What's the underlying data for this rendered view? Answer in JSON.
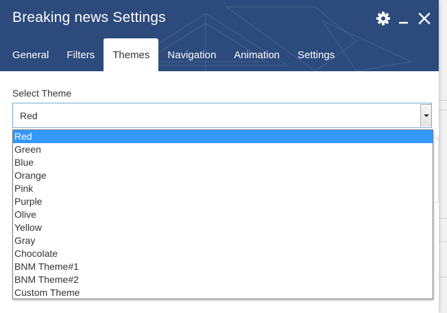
{
  "dialog": {
    "title": "Breaking news Settings",
    "icons": {
      "settings": "gear-icon",
      "minimize": "minimize-icon",
      "close": "close-icon"
    },
    "header_color": "#2c4a7c"
  },
  "tabs": [
    {
      "label": "General",
      "active": false
    },
    {
      "label": "Filters",
      "active": false
    },
    {
      "label": "Themes",
      "active": true
    },
    {
      "label": "Navigation",
      "active": false
    },
    {
      "label": "Animation",
      "active": false
    },
    {
      "label": "Settings",
      "active": false
    }
  ],
  "theme": {
    "label": "Select Theme",
    "selected": "Red",
    "options": [
      "Red",
      "Green",
      "Blue",
      "Orange",
      "Pink",
      "Purple",
      "Olive",
      "Yellow",
      "Gray",
      "Chocolate",
      "BNM Theme#1",
      "BNM Theme#2",
      "Custom Theme"
    ],
    "highlight_color": "#3399ff"
  }
}
